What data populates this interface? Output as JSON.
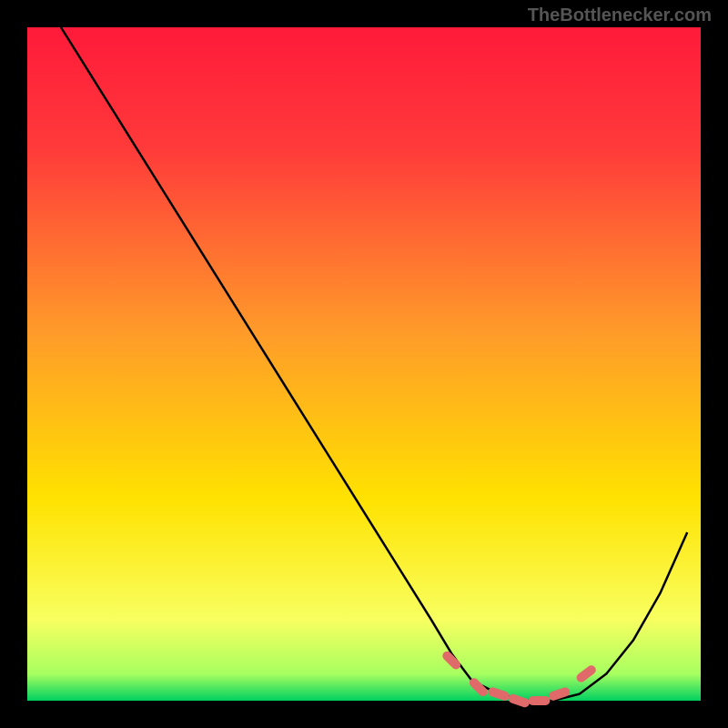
{
  "watermark": "TheBottlenecker.com",
  "chart_data": {
    "type": "line",
    "title": "",
    "xlabel": "",
    "ylabel": "",
    "xlim": [
      0,
      100
    ],
    "ylim": [
      0,
      100
    ],
    "series": [
      {
        "name": "bottleneck-curve",
        "x": [
          5,
          10,
          15,
          20,
          25,
          30,
          35,
          40,
          45,
          50,
          55,
          60,
          63,
          66,
          70,
          74,
          78,
          82,
          86,
          90,
          94,
          98
        ],
        "y": [
          100,
          92,
          84,
          76,
          68,
          60,
          52,
          44,
          36,
          28,
          20,
          12,
          7,
          3,
          1,
          0,
          0,
          1,
          4,
          9,
          16,
          25
        ]
      }
    ],
    "markers": {
      "name": "highlighted-points",
      "x": [
        63,
        67,
        70,
        73,
        76,
        79,
        83
      ],
      "y": [
        6,
        2,
        1,
        0,
        0,
        1,
        4
      ]
    },
    "grid": false,
    "background": {
      "top_color": "#ff1a3a",
      "mid_color": "#ffe200",
      "bottom_color": "#00d060"
    }
  }
}
